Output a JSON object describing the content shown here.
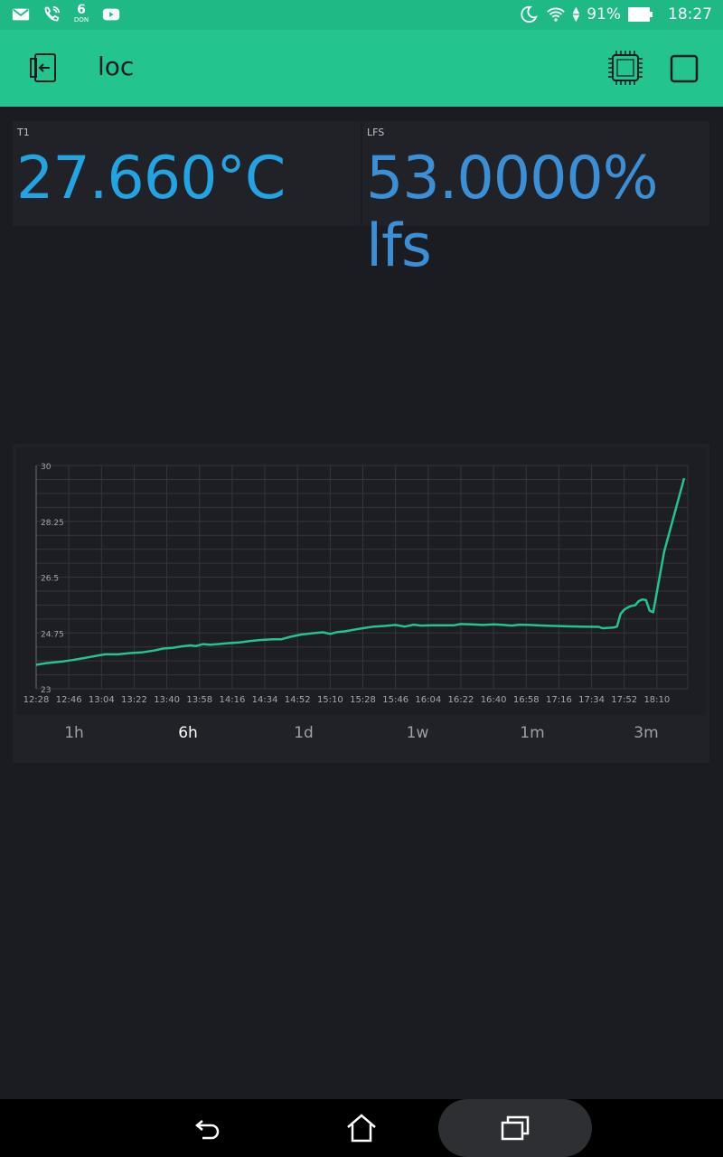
{
  "status_bar": {
    "calendar_day": "6",
    "calendar_label": "DON",
    "battery": "91%",
    "time": "18:27",
    "icons": [
      "mail-icon",
      "phone-wifi-icon",
      "calendar-icon",
      "youtube-icon",
      "moon-icon",
      "wifi-icon",
      "battery-icon"
    ]
  },
  "app_bar": {
    "title": "loc",
    "icons": [
      "back-icon",
      "chip-icon",
      "stop-icon"
    ]
  },
  "widgets": [
    {
      "label": "T1",
      "value": "27.660°C",
      "color": "#22a3e2"
    },
    {
      "label": "LFS",
      "value": "53.0000% lfs",
      "color": "#3a8fd6"
    }
  ],
  "chart_data": {
    "type": "line",
    "line_color": "#23c48e",
    "grid": true,
    "ylim": [
      23,
      30
    ],
    "y_ticks": [
      "30",
      "28.25",
      "26.5",
      "24.75",
      "23"
    ],
    "x_ticks": [
      "12:28",
      "12:46",
      "13:04",
      "13:22",
      "13:40",
      "13:58",
      "14:16",
      "14:34",
      "14:52",
      "15:10",
      "15:28",
      "15:46",
      "16:04",
      "16:22",
      "16:40",
      "16:58",
      "17:16",
      "17:34",
      "17:52",
      "18:10"
    ],
    "x_minutes": [
      0,
      18,
      36,
      54,
      72,
      90,
      108,
      126,
      144,
      162,
      180,
      198,
      216,
      234,
      252,
      270,
      288,
      306,
      324,
      342
    ],
    "points": [
      [
        0,
        23.75
      ],
      [
        5,
        23.8
      ],
      [
        10,
        23.83
      ],
      [
        15,
        23.86
      ],
      [
        20,
        23.9
      ],
      [
        25,
        23.95
      ],
      [
        30,
        24.0
      ],
      [
        35,
        24.05
      ],
      [
        38,
        24.08
      ],
      [
        45,
        24.08
      ],
      [
        52,
        24.12
      ],
      [
        58,
        24.14
      ],
      [
        65,
        24.2
      ],
      [
        70,
        24.26
      ],
      [
        75,
        24.28
      ],
      [
        80,
        24.33
      ],
      [
        85,
        24.36
      ],
      [
        88,
        24.34
      ],
      [
        92,
        24.4
      ],
      [
        96,
        24.38
      ],
      [
        100,
        24.4
      ],
      [
        106,
        24.43
      ],
      [
        112,
        24.45
      ],
      [
        118,
        24.5
      ],
      [
        124,
        24.53
      ],
      [
        130,
        24.55
      ],
      [
        135,
        24.55
      ],
      [
        140,
        24.63
      ],
      [
        146,
        24.7
      ],
      [
        152,
        24.74
      ],
      [
        158,
        24.77
      ],
      [
        162,
        24.72
      ],
      [
        166,
        24.78
      ],
      [
        170,
        24.8
      ],
      [
        175,
        24.85
      ],
      [
        180,
        24.9
      ],
      [
        186,
        24.95
      ],
      [
        192,
        24.97
      ],
      [
        198,
        25.0
      ],
      [
        203,
        24.95
      ],
      [
        208,
        25.01
      ],
      [
        212,
        24.98
      ],
      [
        218,
        24.99
      ],
      [
        224,
        24.99
      ],
      [
        230,
        24.99
      ],
      [
        234,
        25.03
      ],
      [
        240,
        25.02
      ],
      [
        246,
        25.0
      ],
      [
        252,
        25.02
      ],
      [
        258,
        25.0
      ],
      [
        262,
        24.98
      ],
      [
        266,
        25.01
      ],
      [
        272,
        25.0
      ],
      [
        280,
        24.98
      ],
      [
        290,
        24.96
      ],
      [
        300,
        24.95
      ],
      [
        310,
        24.94
      ],
      [
        312,
        24.9
      ],
      [
        318,
        24.92
      ],
      [
        320,
        24.95
      ],
      [
        322,
        25.35
      ],
      [
        324,
        25.48
      ],
      [
        326,
        25.55
      ],
      [
        328,
        25.6
      ],
      [
        330,
        25.62
      ],
      [
        332,
        25.75
      ],
      [
        334,
        25.8
      ],
      [
        336,
        25.78
      ],
      [
        338,
        25.45
      ],
      [
        340,
        25.4
      ],
      [
        346,
        27.3
      ],
      [
        357,
        29.6
      ]
    ]
  },
  "periods": {
    "active": "6h",
    "items": [
      "1h",
      "6h",
      "1d",
      "1w",
      "1m",
      "3m"
    ]
  },
  "nav_bar": {
    "icons": [
      "nav-back-icon",
      "nav-home-icon",
      "nav-recents-icon"
    ]
  }
}
